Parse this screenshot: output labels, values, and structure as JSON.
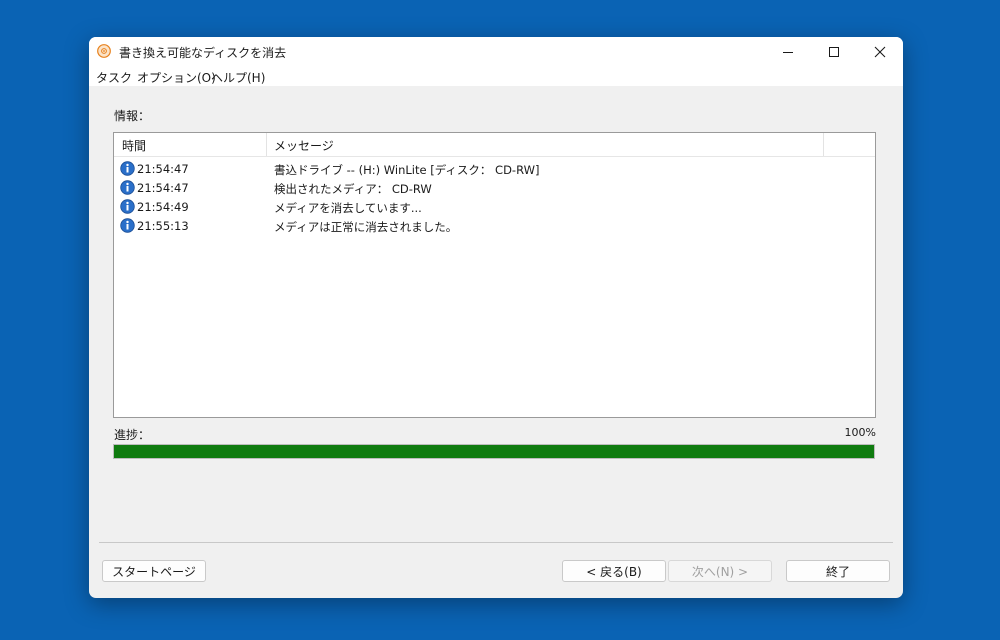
{
  "window": {
    "title": "書き換え可能なディスクを消去",
    "controls": [
      "minimize",
      "maximize",
      "close"
    ]
  },
  "menu": [
    "タスク",
    "オプション(O)",
    "ヘルプ(H)"
  ],
  "info_label": "情報：",
  "log": {
    "columns": [
      "時間",
      "メッセージ"
    ],
    "rows": [
      {
        "time": "21:54:47",
        "message": "書込ドライブ -- (H:) WinLite [ディスク： CD-RW]",
        "icon": "info-icon"
      },
      {
        "time": "21:54:47",
        "message": "検出されたメディア： CD-RW",
        "icon": "info-icon"
      },
      {
        "time": "21:54:49",
        "message": "メディアを消去しています...",
        "icon": "info-icon"
      },
      {
        "time": "21:55:13",
        "message": "メディアは正常に消去されました。",
        "icon": "info-icon"
      }
    ]
  },
  "progress": {
    "label": "進捗：",
    "percent_text": "100%",
    "value": 1.0,
    "color": "#0f7b0f"
  },
  "buttons": {
    "start_page": "スタートページ",
    "back": "< 戻る(B)",
    "next": "次へ(N) >",
    "finish": "終了"
  },
  "colors": {
    "desktop": "#0a63b4",
    "accent_progress": "#0f7b0f",
    "app_icon": "#e8821e"
  }
}
